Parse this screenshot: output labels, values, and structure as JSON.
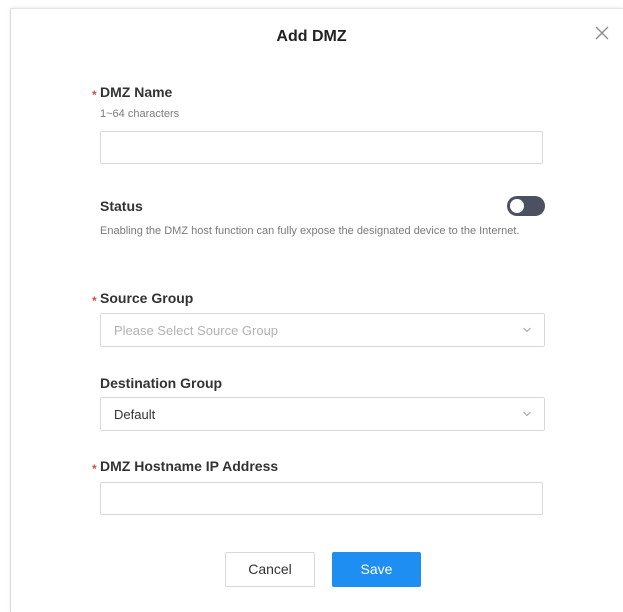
{
  "dialog": {
    "title": "Add DMZ",
    "close_icon": "close-icon"
  },
  "form": {
    "required_marker": "*",
    "dmz_name": {
      "label": "DMZ Name",
      "hint": "1~64 characters",
      "value": "",
      "placeholder": ""
    },
    "status": {
      "label": "Status",
      "enabled": false,
      "description": "Enabling the DMZ host function can fully expose the designated device to the Internet."
    },
    "source_group": {
      "label": "Source Group",
      "placeholder": "Please Select Source Group",
      "value": ""
    },
    "destination_group": {
      "label": "Destination Group",
      "value": "Default"
    },
    "dmz_host_ip": {
      "label": "DMZ Hostname IP Address",
      "value": "",
      "placeholder": ""
    }
  },
  "buttons": {
    "cancel_label": "Cancel",
    "save_label": "Save"
  },
  "colors": {
    "primary": "#1e8ef2",
    "required": "#e3473f",
    "toggle_off": "#4b5160"
  }
}
